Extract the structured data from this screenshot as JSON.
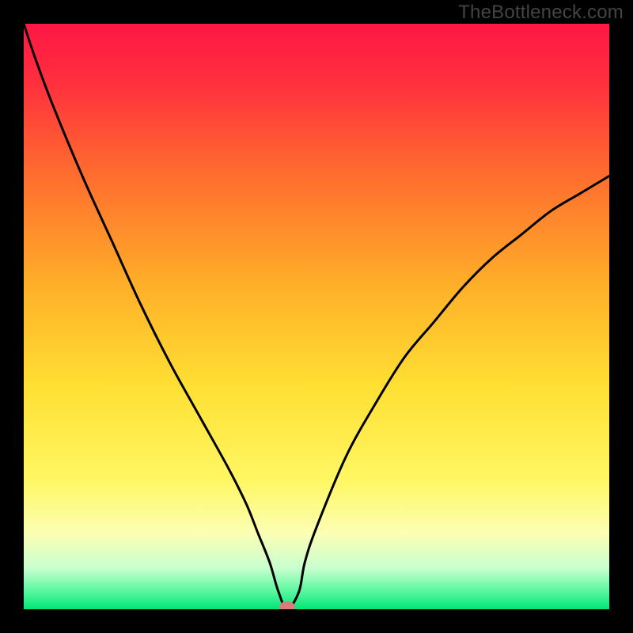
{
  "watermark": "TheBottleneck.com",
  "chart_data": {
    "type": "line",
    "title": "",
    "xlabel": "",
    "ylabel": "",
    "xlim": [
      0,
      100
    ],
    "ylim": [
      0,
      100
    ],
    "grid": false,
    "series": [
      {
        "name": "curve",
        "x": [
          0,
          2,
          5,
          10,
          15,
          20,
          25,
          30,
          35,
          38,
          40,
          42,
          43.5,
          45,
          47,
          48,
          50,
          55,
          60,
          65,
          70,
          75,
          80,
          85,
          90,
          95,
          100
        ],
        "y": [
          100,
          94,
          86,
          74,
          63,
          52,
          42,
          33,
          24,
          18,
          13,
          8,
          3,
          0,
          3,
          8,
          14,
          26,
          35,
          43,
          49,
          55,
          60,
          64,
          68,
          71,
          74
        ]
      }
    ],
    "marker": {
      "x": 45,
      "y": 0
    },
    "gradient_stops": [
      {
        "offset": 0.0,
        "color": "#ff1744"
      },
      {
        "offset": 0.1,
        "color": "#ff2f3e"
      },
      {
        "offset": 0.25,
        "color": "#ff6a2f"
      },
      {
        "offset": 0.45,
        "color": "#ffb028"
      },
      {
        "offset": 0.62,
        "color": "#ffe033"
      },
      {
        "offset": 0.78,
        "color": "#fff763"
      },
      {
        "offset": 0.87,
        "color": "#fcffb4"
      },
      {
        "offset": 0.93,
        "color": "#c8ffd0"
      },
      {
        "offset": 0.97,
        "color": "#57f79e"
      },
      {
        "offset": 1.0,
        "color": "#00e676"
      }
    ],
    "marker_color": "#d97c7c"
  }
}
